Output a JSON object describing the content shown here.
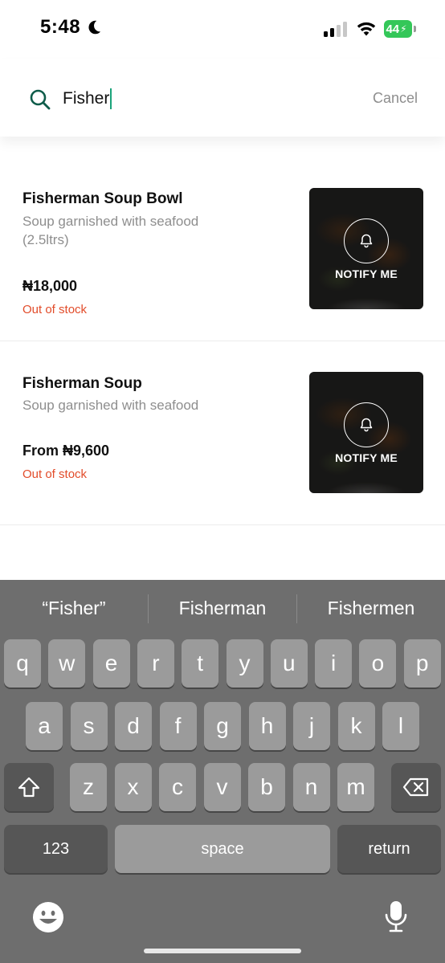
{
  "status_bar": {
    "time": "5:48",
    "battery": "44"
  },
  "search": {
    "query": "Fisher",
    "cancel_label": "Cancel"
  },
  "products": [
    {
      "name": "Fisherman Soup Bowl",
      "description": "Soup garnished with seafood (2.5ltrs)",
      "price": "₦18,000",
      "stock_status": "Out of stock",
      "overlay_label": "NOTIFY ME"
    },
    {
      "name": "Fisherman Soup",
      "description": "Soup garnished with seafood",
      "price": "From ₦9,600",
      "stock_status": "Out of stock",
      "overlay_label": "NOTIFY ME"
    }
  ],
  "keyboard": {
    "suggestions": [
      "“Fisher”",
      "Fisherman",
      "Fishermen"
    ],
    "row1": [
      "q",
      "w",
      "e",
      "r",
      "t",
      "y",
      "u",
      "i",
      "o",
      "p"
    ],
    "row2": [
      "a",
      "s",
      "d",
      "f",
      "g",
      "h",
      "j",
      "k",
      "l"
    ],
    "row3": [
      "z",
      "x",
      "c",
      "v",
      "b",
      "n",
      "m"
    ],
    "numbers_label": "123",
    "space_label": "space",
    "return_label": "return"
  },
  "colors": {
    "accent": "#1aa37a",
    "out_of_stock": "#e24c2a",
    "muted_text": "#8e8e8e",
    "battery": "#34c759"
  }
}
